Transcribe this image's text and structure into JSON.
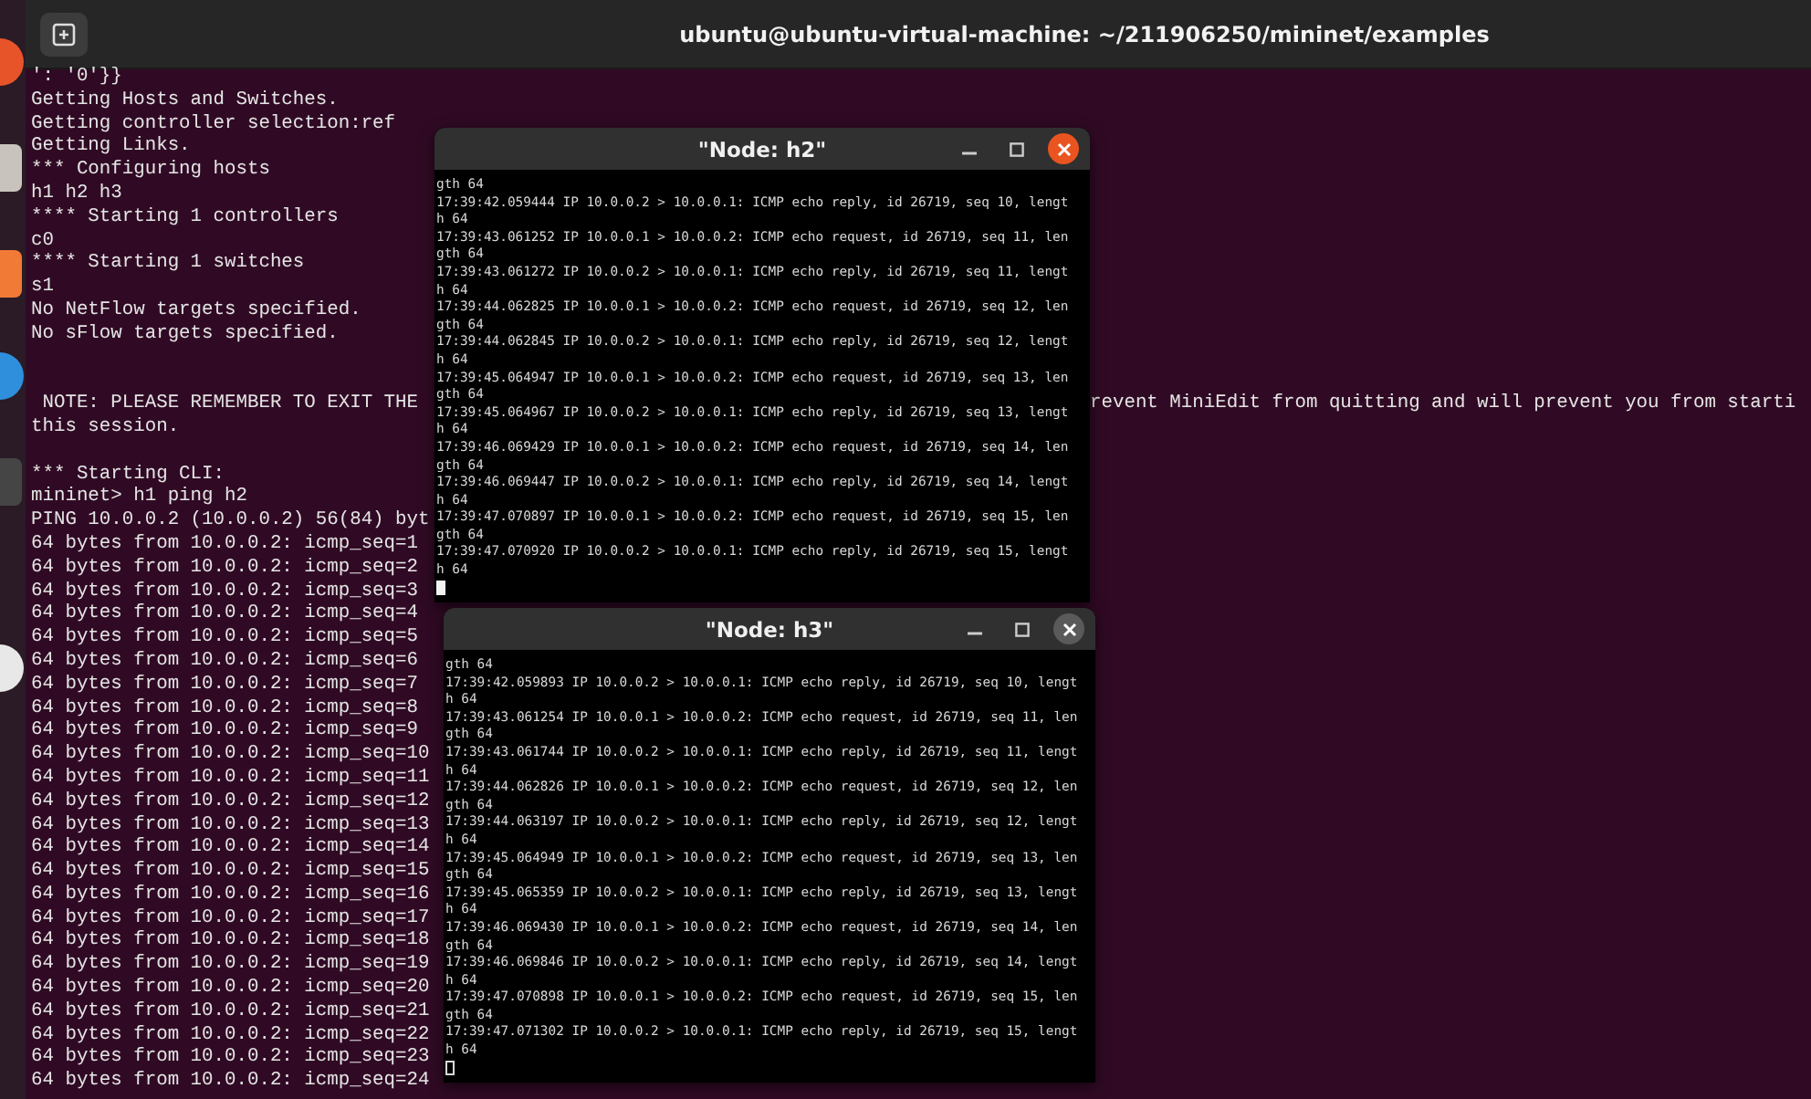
{
  "terminal": {
    "title": "ubuntu@ubuntu-virtual-machine: ~/211906250/mininet/examples",
    "lines": [
      {
        "kind": "text",
        "text": "': '0'}}"
      },
      {
        "kind": "text",
        "text": "Getting Hosts and Switches."
      },
      {
        "kind": "text",
        "text": "Getting controller selection:ref"
      },
      {
        "kind": "text",
        "text": "Getting Links."
      },
      {
        "kind": "text",
        "text": "*** Configuring hosts"
      },
      {
        "kind": "text",
        "text": "h1 h2 h3"
      },
      {
        "kind": "text",
        "text": "**** Starting 1 controllers"
      },
      {
        "kind": "text",
        "text": "c0"
      },
      {
        "kind": "text",
        "text": "**** Starting 1 switches"
      },
      {
        "kind": "text",
        "text": "s1"
      },
      {
        "kind": "text",
        "text": "No NetFlow targets specified."
      },
      {
        "kind": "text",
        "text": "No sFlow targets specified."
      },
      {
        "kind": "blank"
      },
      {
        "kind": "blank"
      },
      {
        "kind": "text",
        "text": " NOTE: PLEASE REMEMBER TO EXIT THE",
        "continuation": "revent MiniEdit from quitting and will prevent you from starti"
      },
      {
        "kind": "text",
        "text": "this session."
      },
      {
        "kind": "blank"
      },
      {
        "kind": "text",
        "text": "*** Starting CLI:"
      },
      {
        "kind": "text",
        "text": "mininet> h1 ping h2"
      },
      {
        "kind": "text",
        "text": "PING 10.0.0.2 (10.0.0.2) 56(84) byt"
      },
      {
        "kind": "text",
        "text": "64 bytes from 10.0.0.2: icmp_seq=1"
      },
      {
        "kind": "text",
        "text": "64 bytes from 10.0.0.2: icmp_seq=2"
      },
      {
        "kind": "text",
        "text": "64 bytes from 10.0.0.2: icmp_seq=3"
      },
      {
        "kind": "text",
        "text": "64 bytes from 10.0.0.2: icmp_seq=4"
      },
      {
        "kind": "text",
        "text": "64 bytes from 10.0.0.2: icmp_seq=5"
      },
      {
        "kind": "text",
        "text": "64 bytes from 10.0.0.2: icmp_seq=6"
      },
      {
        "kind": "text",
        "text": "64 bytes from 10.0.0.2: icmp_seq=7"
      },
      {
        "kind": "text",
        "text": "64 bytes from 10.0.0.2: icmp_seq=8"
      },
      {
        "kind": "text",
        "text": "64 bytes from 10.0.0.2: icmp_seq=9"
      },
      {
        "kind": "text",
        "text": "64 bytes from 10.0.0.2: icmp_seq=10"
      },
      {
        "kind": "text",
        "text": "64 bytes from 10.0.0.2: icmp_seq=11"
      },
      {
        "kind": "text",
        "text": "64 bytes from 10.0.0.2: icmp_seq=12"
      },
      {
        "kind": "text",
        "text": "64 bytes from 10.0.0.2: icmp_seq=13"
      },
      {
        "kind": "text",
        "text": "64 bytes from 10.0.0.2: icmp_seq=14"
      },
      {
        "kind": "text",
        "text": "64 bytes from 10.0.0.2: icmp_seq=15"
      },
      {
        "kind": "text",
        "text": "64 bytes from 10.0.0.2: icmp_seq=16"
      },
      {
        "kind": "text",
        "text": "64 bytes from 10.0.0.2: icmp_seq=17"
      },
      {
        "kind": "text",
        "text": "64 bytes from 10.0.0.2: icmp_seq=18"
      },
      {
        "kind": "text",
        "text": "64 bytes from 10.0.0.2: icmp_seq=19"
      },
      {
        "kind": "text",
        "text": "64 bytes from 10.0.0.2: icmp_seq=20"
      },
      {
        "kind": "text",
        "text": "64 bytes from 10.0.0.2: icmp_seq=21"
      },
      {
        "kind": "text",
        "text": "64 bytes from 10.0.0.2: icmp_seq=22"
      },
      {
        "kind": "text",
        "text": "64 bytes from 10.0.0.2: icmp_seq=23"
      },
      {
        "kind": "text",
        "text": "64 bytes from 10.0.0.2: icmp_seq=24"
      }
    ]
  },
  "node_windows": [
    {
      "title": "\"Node: h2\"",
      "active": true,
      "lines": [
        "gth 64",
        "17:39:42.059444 IP 10.0.0.2 > 10.0.0.1: ICMP echo reply, id 26719, seq 10, lengt",
        "h 64",
        "17:39:43.061252 IP 10.0.0.1 > 10.0.0.2: ICMP echo request, id 26719, seq 11, len",
        "gth 64",
        "17:39:43.061272 IP 10.0.0.2 > 10.0.0.1: ICMP echo reply, id 26719, seq 11, lengt",
        "h 64",
        "17:39:44.062825 IP 10.0.0.1 > 10.0.0.2: ICMP echo request, id 26719, seq 12, len",
        "gth 64",
        "17:39:44.062845 IP 10.0.0.2 > 10.0.0.1: ICMP echo reply, id 26719, seq 12, lengt",
        "h 64",
        "17:39:45.064947 IP 10.0.0.1 > 10.0.0.2: ICMP echo request, id 26719, seq 13, len",
        "gth 64",
        "17:39:45.064967 IP 10.0.0.2 > 10.0.0.1: ICMP echo reply, id 26719, seq 13, lengt",
        "h 64",
        "17:39:46.069429 IP 10.0.0.1 > 10.0.0.2: ICMP echo request, id 26719, seq 14, len",
        "gth 64",
        "17:39:46.069447 IP 10.0.0.2 > 10.0.0.1: ICMP echo reply, id 26719, seq 14, lengt",
        "h 64",
        "17:39:47.070897 IP 10.0.0.1 > 10.0.0.2: ICMP echo request, id 26719, seq 15, len",
        "gth 64",
        "17:39:47.070920 IP 10.0.0.2 > 10.0.0.1: ICMP echo reply, id 26719, seq 15, lengt",
        "h 64"
      ]
    },
    {
      "title": "\"Node: h3\"",
      "active": false,
      "lines": [
        "gth 64",
        "17:39:42.059893 IP 10.0.0.2 > 10.0.0.1: ICMP echo reply, id 26719, seq 10, lengt",
        "h 64",
        "17:39:43.061254 IP 10.0.0.1 > 10.0.0.2: ICMP echo request, id 26719, seq 11, len",
        "gth 64",
        "17:39:43.061744 IP 10.0.0.2 > 10.0.0.1: ICMP echo reply, id 26719, seq 11, lengt",
        "h 64",
        "17:39:44.062826 IP 10.0.0.1 > 10.0.0.2: ICMP echo request, id 26719, seq 12, len",
        "gth 64",
        "17:39:44.063197 IP 10.0.0.2 > 10.0.0.1: ICMP echo reply, id 26719, seq 12, lengt",
        "h 64",
        "17:39:45.064949 IP 10.0.0.1 > 10.0.0.2: ICMP echo request, id 26719, seq 13, len",
        "gth 64",
        "17:39:45.065359 IP 10.0.0.2 > 10.0.0.1: ICMP echo reply, id 26719, seq 13, lengt",
        "h 64",
        "17:39:46.069430 IP 10.0.0.1 > 10.0.0.2: ICMP echo request, id 26719, seq 14, len",
        "gth 64",
        "17:39:46.069846 IP 10.0.0.2 > 10.0.0.1: ICMP echo reply, id 26719, seq 14, lengt",
        "h 64",
        "17:39:47.070898 IP 10.0.0.1 > 10.0.0.2: ICMP echo request, id 26719, seq 15, len",
        "gth 64",
        "17:39:47.071302 IP 10.0.0.2 > 10.0.0.1: ICMP echo reply, id 26719, seq 15, lengt",
        "h 64"
      ]
    }
  ]
}
